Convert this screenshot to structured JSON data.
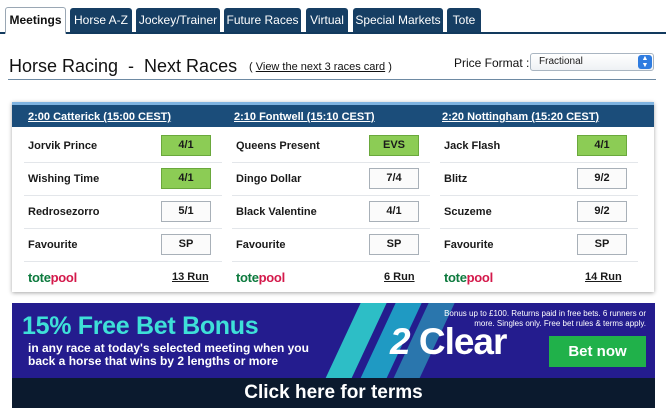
{
  "tabs": [
    {
      "label": "Meetings",
      "active": true
    },
    {
      "label": "Horse A-Z",
      "active": false
    },
    {
      "label": "Jockey/Trainer",
      "active": false
    },
    {
      "label": "Future Races",
      "active": false
    },
    {
      "label": "Virtual",
      "active": false
    },
    {
      "label": "Special Markets",
      "active": false
    },
    {
      "label": "Tote",
      "active": false
    }
  ],
  "header": {
    "title": "Horse Racing  -  Next Races",
    "view_next_open": "( ",
    "view_next_link": "View the next 3 races card",
    "view_next_close": " )",
    "price_format_label": "Price Format :",
    "price_format_value": "Fractional"
  },
  "races": [
    {
      "title": "2:00 Catterick (15:00 CEST)",
      "runners": [
        {
          "name": "Jorvik Prince",
          "odds": "4/1",
          "highlight": true
        },
        {
          "name": "Wishing Time",
          "odds": "4/1",
          "highlight": true
        },
        {
          "name": "Redrosezorro",
          "odds": "5/1",
          "highlight": false
        },
        {
          "name": "Favourite",
          "odds": "SP",
          "highlight": false
        }
      ],
      "tote_a": "tote",
      "tote_b": "pool",
      "run": "13 Run"
    },
    {
      "title": "2:10 Fontwell (15:10 CEST)",
      "runners": [
        {
          "name": "Queens Present",
          "odds": "EVS",
          "highlight": true
        },
        {
          "name": "Dingo Dollar",
          "odds": "7/4",
          "highlight": false
        },
        {
          "name": "Black Valentine",
          "odds": "4/1",
          "highlight": false
        },
        {
          "name": "Favourite",
          "odds": "SP",
          "highlight": false
        }
      ],
      "tote_a": "tote",
      "tote_b": "pool",
      "run": "6 Run"
    },
    {
      "title": "2:20 Nottingham (15:20 CEST)",
      "runners": [
        {
          "name": "Jack Flash",
          "odds": "4/1",
          "highlight": true
        },
        {
          "name": "Blitz",
          "odds": "9/2",
          "highlight": false
        },
        {
          "name": "Scuzeme",
          "odds": "9/2",
          "highlight": false
        },
        {
          "name": "Favourite",
          "odds": "SP",
          "highlight": false
        }
      ],
      "tote_a": "tote",
      "tote_b": "pool",
      "run": "14 Run"
    }
  ],
  "banner": {
    "headline": "15% Free Bet Bonus",
    "sub": "in any race at today's selected meeting when you back a horse that wins by 2 lengths or more",
    "logo_number": "2",
    "logo_word": "Clear",
    "small_print": "Bonus up to £100. Returns paid in free bets. 6 runners or more. Singles only. Free bet rules & terms apply.",
    "cta": "Bet now",
    "terms": "Click here for terms"
  },
  "colors": {
    "tab_bg": "#163e63",
    "race_header_bg": "#1b4d7a",
    "odds_highlight": "#8ccc55",
    "banner_bg": "#241c8e",
    "banner_accent": "#3ee0d8",
    "cta_green": "#20b14a",
    "terms_bg": "#0b1a2e"
  }
}
